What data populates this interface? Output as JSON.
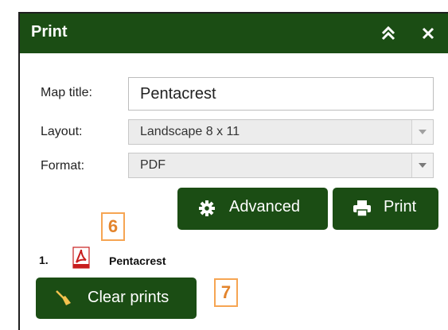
{
  "panel": {
    "title": "Print",
    "collapse_icon": "double-chevron-up-icon",
    "close_icon": "close-icon"
  },
  "form": {
    "map_title": {
      "label": "Map title:",
      "value": "Pentacrest"
    },
    "layout": {
      "label": "Layout:",
      "value": "Landscape 8 x 11"
    },
    "format": {
      "label": "Format:",
      "value": "PDF"
    }
  },
  "buttons": {
    "advanced": {
      "label": "Advanced",
      "icon": "gear-icon"
    },
    "print": {
      "label": "Print",
      "icon": "printer-icon"
    },
    "clear": {
      "label": "Clear prints",
      "icon": "broom-icon"
    }
  },
  "prints": [
    {
      "number": "1.",
      "icon": "pdf-icon",
      "name": "Pentacrest"
    }
  ],
  "callouts": [
    "6",
    "7"
  ],
  "colors": {
    "accent": "#1b4d14",
    "callout": "#f6a553",
    "pdf_red": "#c81e1e"
  }
}
